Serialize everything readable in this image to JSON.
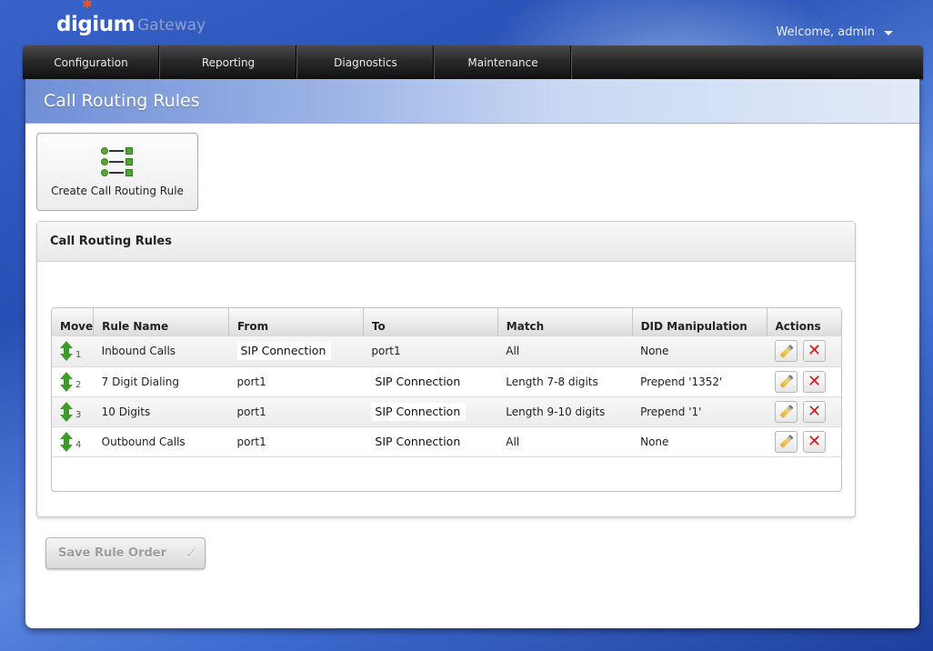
{
  "brand": {
    "name": "digium",
    "product": "Gateway"
  },
  "user": {
    "welcome": "Welcome, admin"
  },
  "nav": {
    "items": [
      "Configuration",
      "Reporting",
      "Diagnostics",
      "Maintenance"
    ]
  },
  "page": {
    "title": "Call Routing Rules"
  },
  "toolbar": {
    "create_label": "Create Call Routing Rule"
  },
  "rules_panel": {
    "title": "Call Routing Rules",
    "columns": [
      "Move",
      "Rule Name",
      "From",
      "To",
      "Match",
      "DID Manipulation",
      "Actions"
    ],
    "rows": [
      {
        "num": "1",
        "name": "Inbound Calls",
        "from": "SIP Connection",
        "to": "port1",
        "match": "All",
        "did": "None"
      },
      {
        "num": "2",
        "name": "7 Digit Dialing",
        "from": "port1",
        "to": "SIP Connection",
        "match": "Length 7-8 digits",
        "did": "Prepend '1352'"
      },
      {
        "num": "3",
        "name": "10 Digits",
        "from": "port1",
        "to": "SIP Connection",
        "match": "Length 9-10 digits",
        "did": "Prepend '1'"
      },
      {
        "num": "4",
        "name": "Outbound Calls",
        "from": "port1",
        "to": "SIP Connection",
        "match": "All",
        "did": "None"
      }
    ]
  },
  "footer": {
    "save_label": "Save Rule Order"
  },
  "icons": {
    "move": "move-arrows-icon",
    "edit": "pencil-icon",
    "delete": "delete-x-icon",
    "create": "list-icon"
  },
  "colors": {
    "accent_green": "#3d9a2b",
    "delete_red": "#d21e1e",
    "header_blue": "#6f8fd6"
  }
}
